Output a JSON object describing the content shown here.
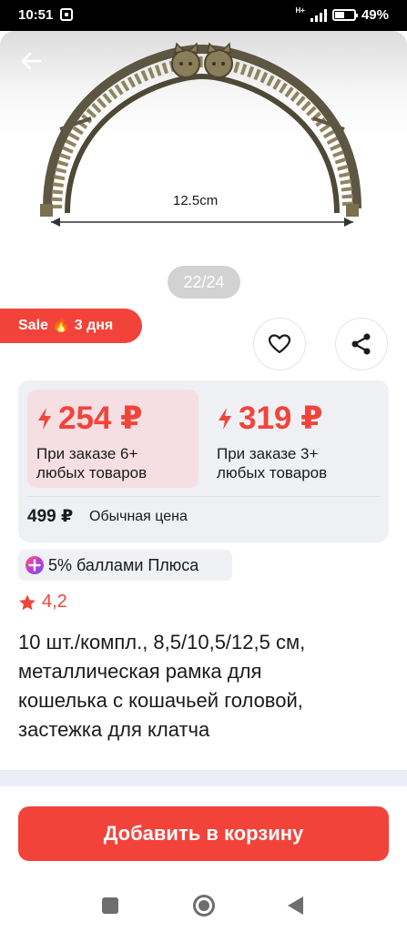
{
  "status_bar": {
    "time": "10:51",
    "network": "H+",
    "battery": "49%"
  },
  "gallery": {
    "dimension_label": "12.5cm",
    "counter": "22/24"
  },
  "badge": {
    "text": "Sale 🔥 3 дня"
  },
  "actions": {
    "favorite_icon": "heart-icon",
    "share_icon": "share-icon"
  },
  "pricing": {
    "options": [
      {
        "price": "254 ₽",
        "note_line1": "При заказе 6+",
        "note_line2": "любых товаров",
        "selected": true
      },
      {
        "price": "319 ₽",
        "note_line1": "При заказе 3+",
        "note_line2": "любых товаров",
        "selected": false
      }
    ],
    "regular_price": "499 ₽",
    "regular_label": "Обычная цена"
  },
  "points": {
    "text": "5% баллами Плюса"
  },
  "rating": {
    "value": "4,2"
  },
  "product": {
    "title_lines": [
      "10 шт./компл., 8,5/10,5/12,5 см,",
      "металлическая рамка для",
      "кошелька с кошачьей головой,",
      "застежка для клатча"
    ]
  },
  "cart": {
    "button_label": "Добавить в корзину"
  },
  "colors": {
    "accent": "#f2433b",
    "card_bg": "#eef0f3",
    "selected_bg": "#f6dfe2"
  }
}
